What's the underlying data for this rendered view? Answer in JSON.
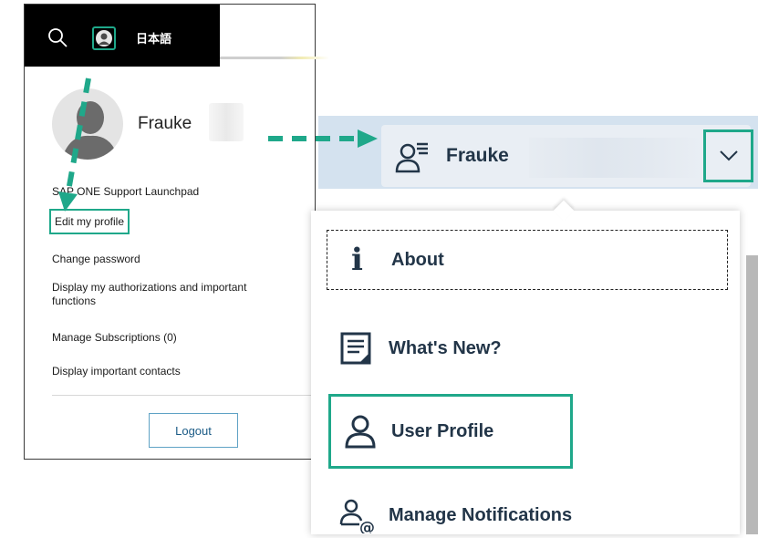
{
  "left_panel": {
    "language_label": "日本語",
    "profile_name": "Frauke",
    "menu": {
      "support_launchpad": "SAP ONE Support Launchpad",
      "edit_profile": "Edit my profile",
      "change_password": "Change password",
      "display_authorizations_line1": "Display my authorizations and important",
      "display_authorizations_line2": "functions",
      "manage_subscriptions": "Manage Subscriptions (0)",
      "display_contacts": "Display important contacts"
    },
    "logout_label": "Logout"
  },
  "shell_bar": {
    "user_name": "Frauke"
  },
  "dropdown": {
    "about": "About",
    "whats_new": "What's New?",
    "user_profile": "User Profile",
    "manage_notifications": "Manage Notifications"
  },
  "colors": {
    "highlight_green": "#1fa88a",
    "shell_blue": "#d4e2ef",
    "text_navy": "#223548"
  },
  "icons": [
    "search-icon",
    "avatar-icon",
    "profile-picture",
    "user-menu-icon",
    "chevron-down-icon",
    "info-icon",
    "whats-new-icon",
    "user-icon",
    "notifications-icon"
  ]
}
